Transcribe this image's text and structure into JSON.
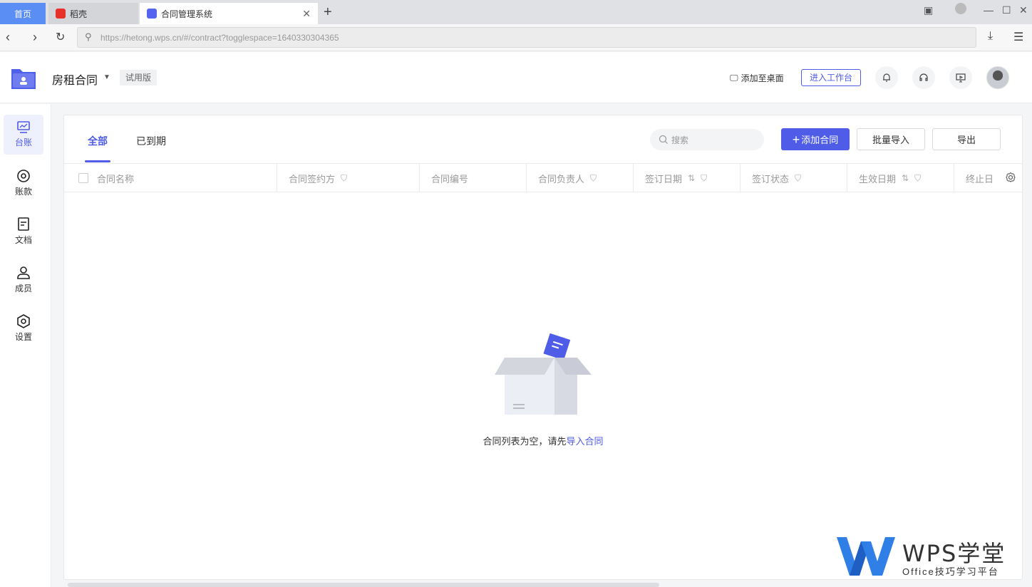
{
  "browser": {
    "home_tab": "首页",
    "tabs": [
      {
        "label": "稻壳"
      },
      {
        "label": "合同管理系统"
      }
    ],
    "url": "https://hetong.wps.cn/#/contract?togglespace=1640330304365"
  },
  "header": {
    "space_name": "房租合同",
    "trial_badge": "试用版",
    "add_to_desktop": "添加至桌面",
    "enter_workspace": "进入工作台"
  },
  "sidebar": {
    "items": [
      {
        "label": "台账",
        "icon": "ledger-icon"
      },
      {
        "label": "账款",
        "icon": "payment-icon"
      },
      {
        "label": "文档",
        "icon": "document-icon"
      },
      {
        "label": "成员",
        "icon": "member-icon"
      },
      {
        "label": "设置",
        "icon": "settings-icon"
      }
    ]
  },
  "main": {
    "tabs": [
      {
        "label": "全部"
      },
      {
        "label": "已到期"
      }
    ],
    "search_placeholder": "搜索",
    "add_button": "添加合同",
    "import_button": "批量导入",
    "export_button": "导出",
    "columns": [
      "合同名称",
      "合同签约方",
      "合同编号",
      "合同负责人",
      "签订日期",
      "签订状态",
      "生效日期",
      "终止日"
    ],
    "empty_text": "合同列表为空，请先",
    "empty_link": "导入合同"
  },
  "watermark": {
    "title": "WPS学堂",
    "subtitle": "Office技巧学习平台"
  },
  "colors": {
    "accent": "#4f5ce8",
    "home_tab": "#5b8ef5"
  }
}
